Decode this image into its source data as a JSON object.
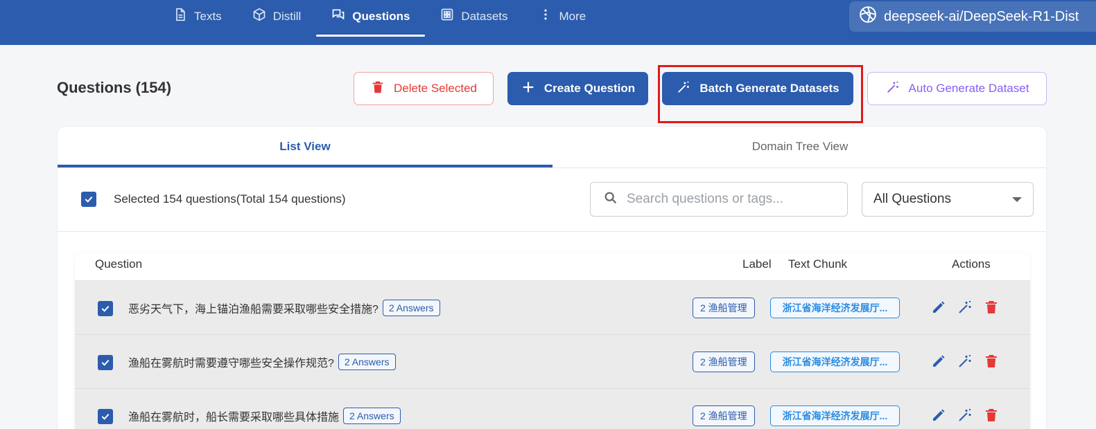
{
  "nav": {
    "items": [
      {
        "label": "Texts",
        "icon": "document-icon",
        "active": false
      },
      {
        "label": "Distill",
        "icon": "cube-icon",
        "active": false
      },
      {
        "label": "Questions",
        "icon": "chat-icon",
        "active": true
      },
      {
        "label": "Datasets",
        "icon": "grid-icon",
        "active": false
      },
      {
        "label": "More",
        "icon": "more-vertical-icon",
        "active": false
      }
    ],
    "model": "deepseek-ai/DeepSeek-R1-Dist"
  },
  "header": {
    "title": "Questions (154)",
    "delete_label": "Delete Selected",
    "create_label": "Create Question",
    "batch_label": "Batch Generate Datasets",
    "auto_label": "Auto Generate Dataset"
  },
  "tabs": {
    "list": "List View",
    "tree": "Domain Tree View"
  },
  "toolbar": {
    "selected_text": "Selected 154 questions(Total 154 questions)",
    "search_placeholder": "Search questions or tags...",
    "filter_value": "All Questions"
  },
  "table": {
    "headers": {
      "question": "Question",
      "label": "Label",
      "chunk": "Text Chunk",
      "actions": "Actions"
    },
    "rows": [
      {
        "question": "恶劣天气下，海上锚泊渔船需要采取哪些安全措施?",
        "answers": "2 Answers",
        "label": "2 渔船管理",
        "chunk": "浙江省海洋经济发展厅..."
      },
      {
        "question": "渔船在雾航时需要遵守哪些安全操作规范?",
        "answers": "2 Answers",
        "label": "2 渔船管理",
        "chunk": "浙江省海洋经济发展厅..."
      },
      {
        "question": "渔船在雾航时，船长需要采取哪些具体措施",
        "answers": "2 Answers",
        "label": "2 渔船管理",
        "chunk": "浙江省海洋经济发展厅..."
      }
    ]
  },
  "colors": {
    "primary": "#2b5cad",
    "danger": "#e53935",
    "purple": "#8a5cf6",
    "highlight": "#e1191b"
  }
}
